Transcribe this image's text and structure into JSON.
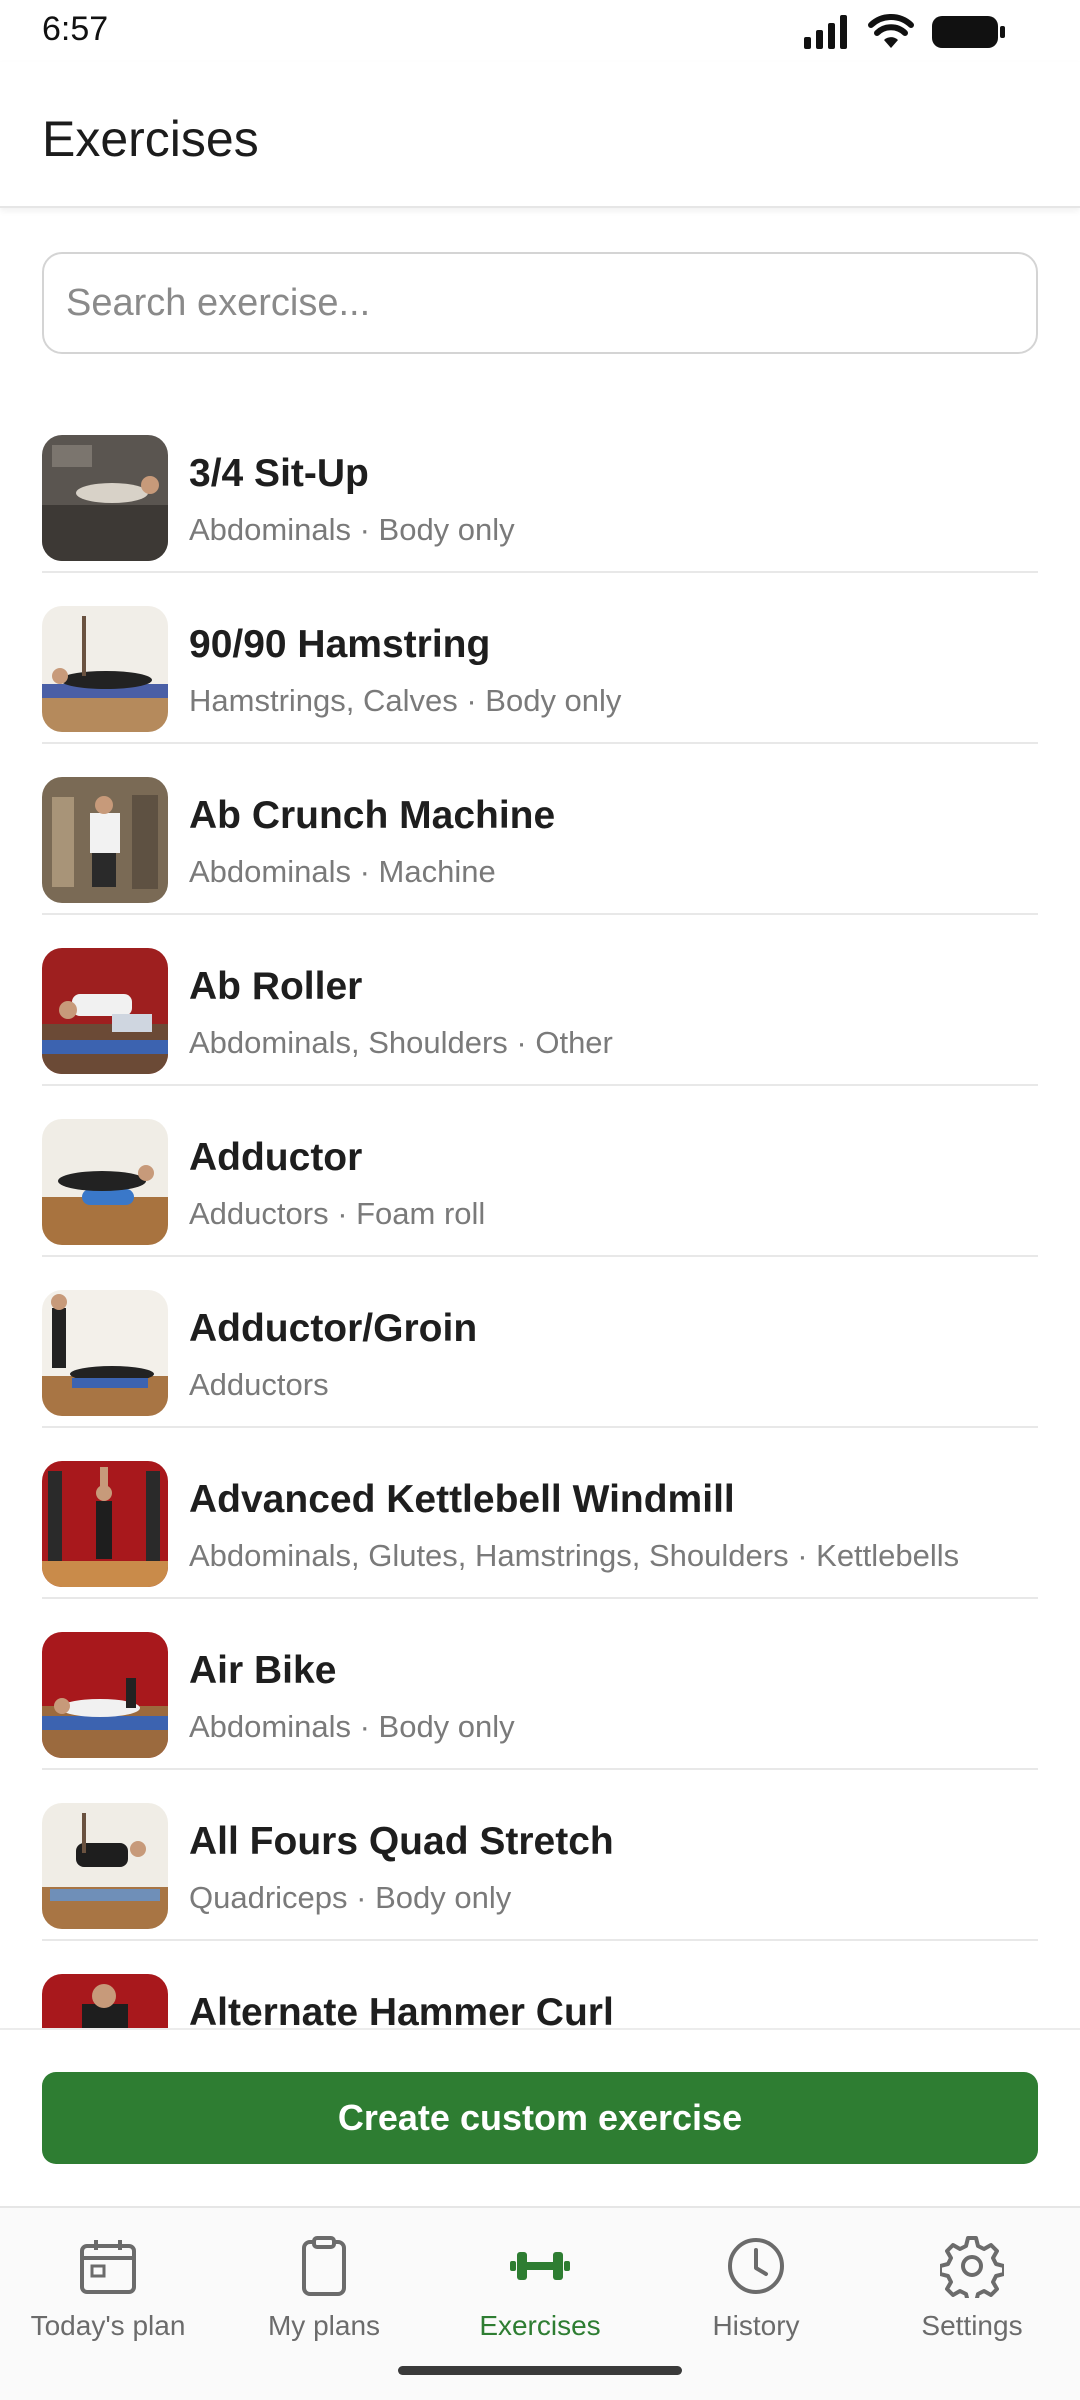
{
  "status": {
    "time": "6:57"
  },
  "header": {
    "title": "Exercises"
  },
  "search": {
    "placeholder": "Search exercise...",
    "value": ""
  },
  "exercises": [
    {
      "name": "3/4 Sit-Up",
      "details": "Abdominals · Body only"
    },
    {
      "name": "90/90 Hamstring",
      "details": "Hamstrings, Calves · Body only"
    },
    {
      "name": "Ab Crunch Machine",
      "details": "Abdominals · Machine"
    },
    {
      "name": "Ab Roller",
      "details": "Abdominals, Shoulders · Other"
    },
    {
      "name": "Adductor",
      "details": "Adductors · Foam roll"
    },
    {
      "name": "Adductor/Groin",
      "details": "Adductors"
    },
    {
      "name": "Advanced Kettlebell Windmill",
      "details": "Abdominals, Glutes, Hamstrings, Shoulders · Kettlebells"
    },
    {
      "name": "Air Bike",
      "details": "Abdominals · Body only"
    },
    {
      "name": "All Fours Quad Stretch",
      "details": "Quadriceps · Body only"
    },
    {
      "name": "Alternate Hammer Curl",
      "details": ""
    }
  ],
  "actions": {
    "create_label": "Create custom exercise"
  },
  "tabs": [
    {
      "label": "Today's plan",
      "icon": "calendar-icon"
    },
    {
      "label": "My plans",
      "icon": "clipboard-icon"
    },
    {
      "label": "Exercises",
      "icon": "dumbbell-icon",
      "active": true
    },
    {
      "label": "History",
      "icon": "clock-icon"
    },
    {
      "label": "Settings",
      "icon": "gear-icon"
    }
  ],
  "colors": {
    "accent": "#2e7d32",
    "inactive": "#6b6b6b",
    "divider": "#e8e8e8"
  }
}
